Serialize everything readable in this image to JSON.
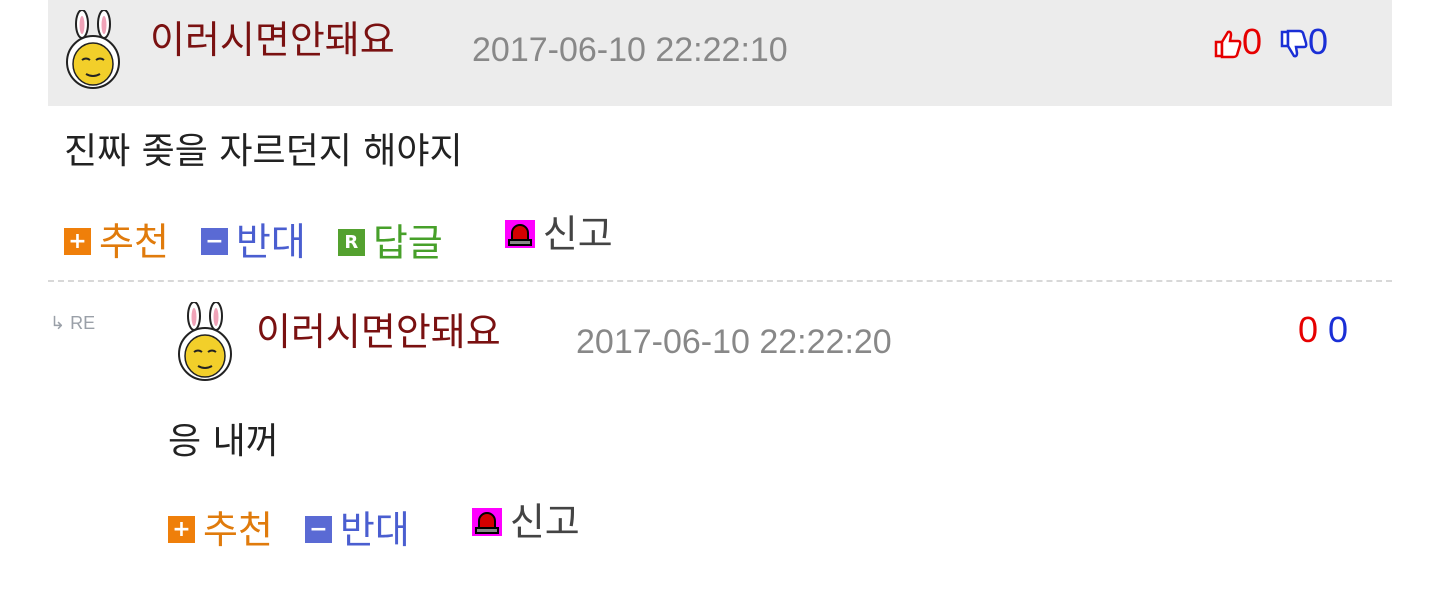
{
  "comment": {
    "author": "이러시면안돼요",
    "timestamp": "2017-06-10 22:22:10",
    "upvotes": "0",
    "downvotes": "0",
    "body": "진짜 좆을 자르던지 해야지",
    "actions": {
      "recommend": "추천",
      "oppose": "반대",
      "reply": "답글",
      "report": "신고"
    }
  },
  "reply": {
    "re_label": "RE",
    "author": "이러시면안돼요",
    "timestamp": "2017-06-10 22:22:20",
    "upvotes": "0",
    "downvotes": "0",
    "body": "응 내꺼",
    "actions": {
      "recommend": "추천",
      "oppose": "반대",
      "report": "신고"
    }
  },
  "icons": {
    "plus": "+",
    "minus": "−",
    "reply": "R"
  },
  "colors": {
    "author": "#7a1111",
    "timestamp": "#888888",
    "upvote": "#e60000",
    "downvote": "#1a2fd6",
    "recommend": "#ef7f0a",
    "oppose": "#5a6ad4",
    "reply": "#54a12f",
    "report": "#ff00ff",
    "header_bg": "#ececec"
  }
}
